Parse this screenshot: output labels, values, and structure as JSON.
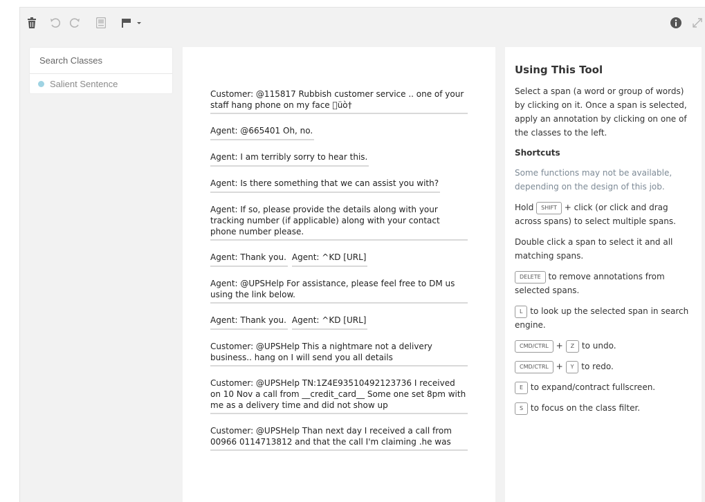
{
  "toolbar": {
    "icons": [
      "trash-icon",
      "undo-icon",
      "redo-icon",
      "notes-icon",
      "flag-icon",
      "info-icon",
      "expand-icon"
    ]
  },
  "classes_panel": {
    "search_placeholder": "Search Classes",
    "items": [
      {
        "label": "Salient Sentence",
        "color": "#9fd3e3"
      }
    ]
  },
  "document": {
    "turns": [
      {
        "segments": [
          "Customer: @115817 Rubbish customer service .. one of your staff hang phone on my face üò†"
        ],
        "full": true
      },
      {
        "segments": [
          "Agent: @665401 Oh, no."
        ],
        "full": false
      },
      {
        "segments": [
          "Agent: I am terribly sorry to hear this."
        ],
        "full": false
      },
      {
        "segments": [
          "Agent: Is there something that we can assist you with?"
        ],
        "full": false
      },
      {
        "segments": [
          "Agent: If so, please provide the details along with your tracking number (if applicable) along with your contact phone number please."
        ],
        "full": true
      },
      {
        "segments": [
          "Agent: Thank you.",
          "Agent: ^KD [URL]"
        ],
        "full": false
      },
      {
        "segments": [
          "Agent: @UPSHelp For assistance, please feel free to DM us using the link below."
        ],
        "full": true
      },
      {
        "segments": [
          "Agent: Thank you.",
          "Agent: ^KD [URL]"
        ],
        "full": false
      },
      {
        "segments": [
          "Customer: @UPSHelp This a nightmare not a delivery business.. hang on I will send you all details"
        ],
        "full": true
      },
      {
        "segments": [
          "Customer: @UPSHelp TN:1Z4E93510492123736 I received on 10 Nov a call from __credit_card__ Some one set 8pm with me as a delivery time and did not show up"
        ],
        "full": true
      },
      {
        "segments": [
          "Customer: @UPSHelp Than next day I received a call from 00966 0114713812 and that the call I'm claiming .he was"
        ],
        "full": true
      }
    ]
  },
  "help": {
    "title": "Using This Tool",
    "intro": "Select a span (a word or group of words) by clicking on it. Once a span is selected, apply an annotation by clicking on one of the classes to the left.",
    "shortcuts_heading": "Shortcuts",
    "note": "Some functions may not be available, depending on the design of this job.",
    "shift_pre": "Hold",
    "shift_key": "SHIFT",
    "shift_post": "+ click (or click and drag across spans) to select multiple spans.",
    "double_click": "Double click a span to select it and all matching spans.",
    "delete_key": "DELETE",
    "delete_post": "to remove annotations from selected spans.",
    "l_key": "L",
    "l_post": "to look up the selected span in search engine.",
    "cmd_key": "CMD/CTRL",
    "plus": "+",
    "z_key": "Z",
    "z_post": "to undo.",
    "y_key": "Y",
    "y_post": "to redo.",
    "e_key": "E",
    "e_post": "to expand/contract fullscreen.",
    "s_key": "S",
    "s_post": "to focus on the class filter."
  }
}
